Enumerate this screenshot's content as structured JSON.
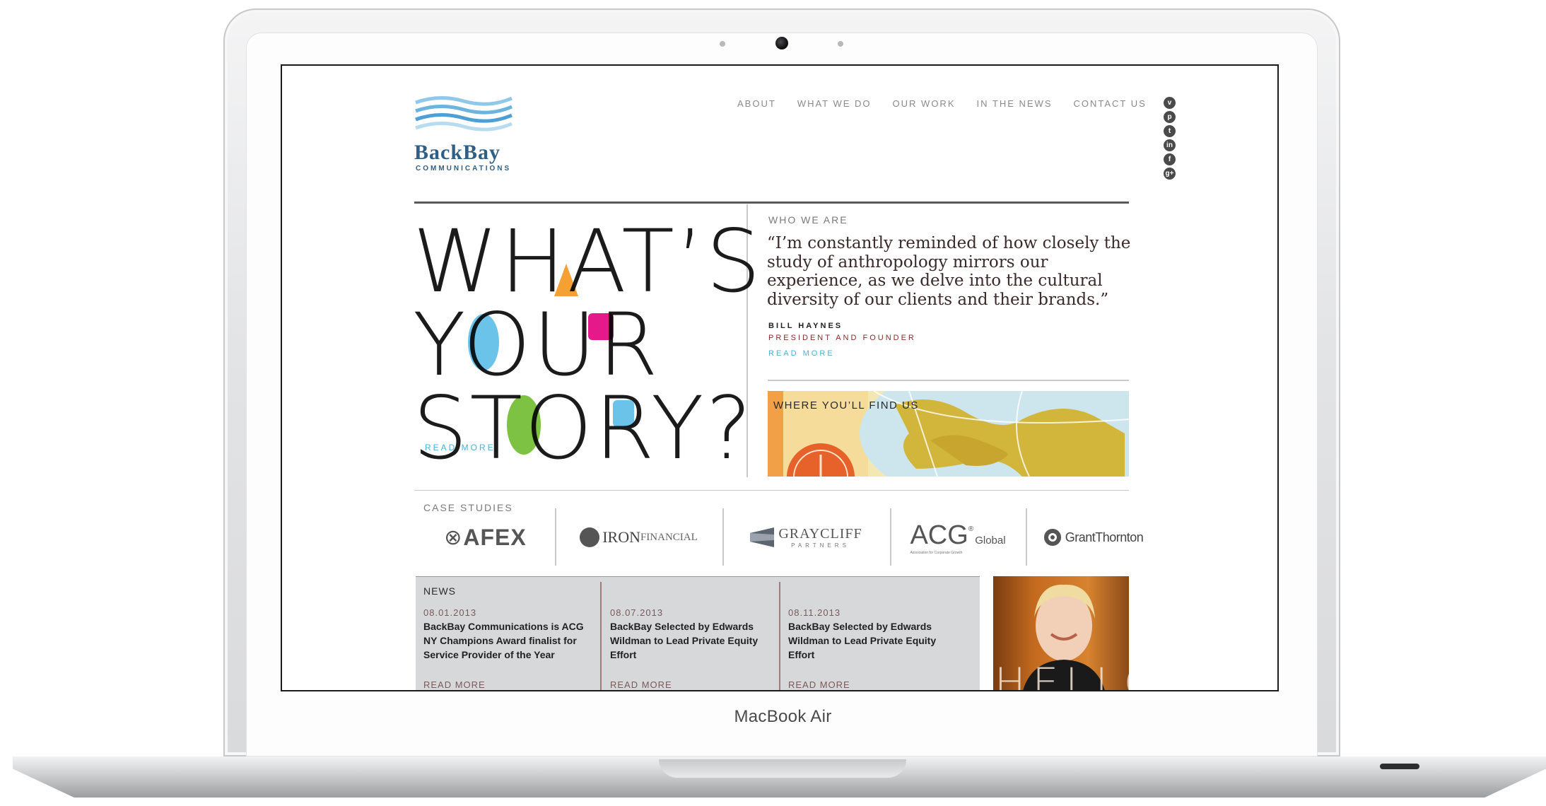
{
  "device": {
    "model_label": "MacBook Air"
  },
  "logo": {
    "name": "BackBay",
    "subtitle": "COMMUNICATIONS"
  },
  "nav": {
    "items": [
      "ABOUT",
      "WHAT WE DO",
      "OUR WORK",
      "IN THE NEWS",
      "CONTACT US"
    ]
  },
  "social_icons": [
    "vimeo-icon",
    "pinterest-icon",
    "twitter-icon",
    "linkedin-icon",
    "facebook-icon",
    "google-plus-icon"
  ],
  "hero": {
    "lines": [
      "WHAT’S",
      "YOUR",
      "STORY?"
    ],
    "read_more": "READ MORE",
    "accent_colors": {
      "orange": "#f5a032",
      "blue": "#6cc3ea",
      "magenta": "#e6198a",
      "green": "#7dc242"
    }
  },
  "who_we_are": {
    "label": "WHO WE ARE",
    "quote": "“I’m constantly reminded of how closely the study of anthropology mirrors our experience, as we delve into the cultural diversity of our clients and their brands.”",
    "author": "BILL HAYNES",
    "role": "PRESIDENT AND FOUNDER",
    "read_more": "READ MORE"
  },
  "find_us": {
    "label": "WHERE YOU’LL FIND US"
  },
  "case_studies": {
    "label": "CASE STUDIES",
    "logos": [
      {
        "name": "AFEX"
      },
      {
        "name": "IRON",
        "suffix": "FINANCIAL"
      },
      {
        "name": "GRAYCLIFF",
        "suffix": "PARTNERS"
      },
      {
        "name": "ACG",
        "suffix": "Global",
        "tagline": "Association for Corporate Growth"
      },
      {
        "name": "GrantThornton"
      }
    ]
  },
  "news": {
    "label": "NEWS",
    "items": [
      {
        "date": "08.01.2013",
        "title": "BackBay Communications is ACG NY Champions Award finalist for Service Provider of the Year",
        "read_more": "READ MORE"
      },
      {
        "date": "08.07.2013",
        "title": "BackBay Selected by Edwards Wildman to Lead Private Equity Effort",
        "read_more": "READ MORE"
      },
      {
        "date": "08.11.2013",
        "title": "BackBay Selected by Edwards Wildman to Lead Private Equity Effort",
        "read_more": "READ MORE"
      }
    ]
  },
  "hello_panel": {
    "text": "HELLO"
  }
}
